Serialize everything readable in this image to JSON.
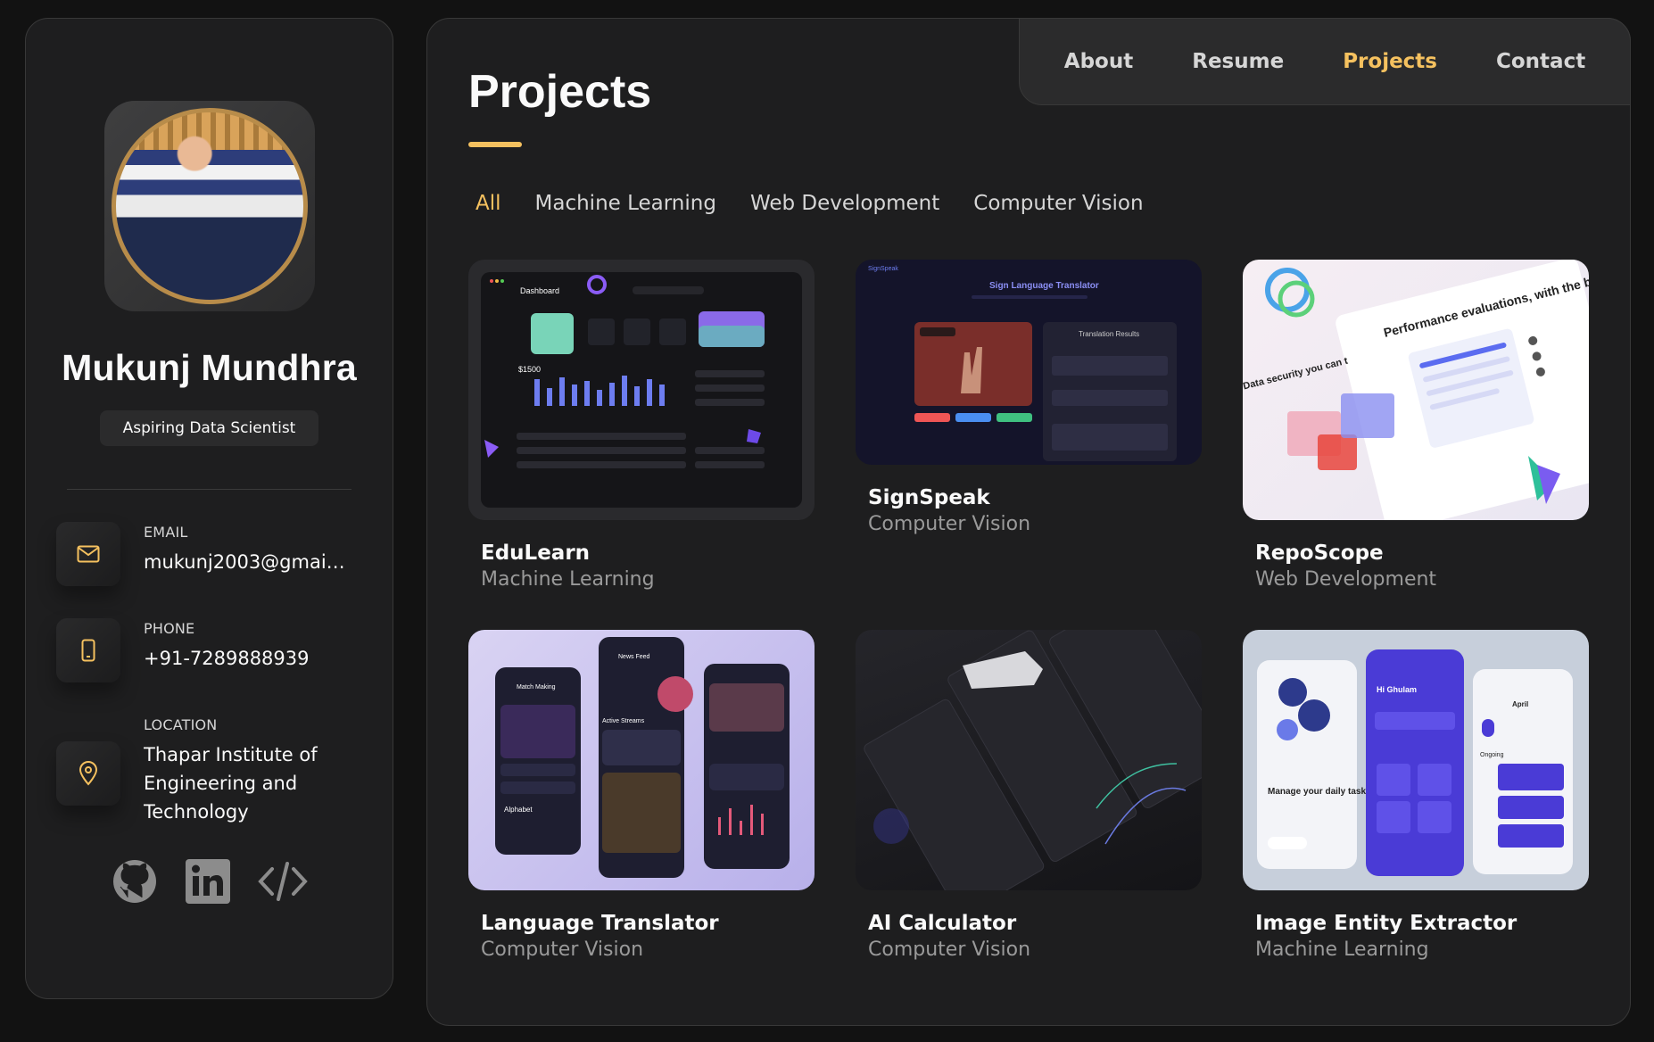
{
  "profile": {
    "name": "Mukunj Mundhra",
    "title": "Aspiring Data Scientist",
    "contacts": [
      {
        "label": "EMAIL",
        "value": "mukunj2003@gmail...",
        "icon": "mail-icon"
      },
      {
        "label": "PHONE",
        "value": "+91-7289888939",
        "icon": "phone-icon"
      },
      {
        "label": "LOCATION",
        "value": "Thapar Institute of Engineering and Technology",
        "icon": "location-pin-icon"
      }
    ],
    "socials": [
      "github-icon",
      "linkedin-icon",
      "code-icon"
    ]
  },
  "nav": {
    "items": [
      "About",
      "Resume",
      "Projects",
      "Contact"
    ],
    "active": "Projects"
  },
  "page": {
    "title": "Projects"
  },
  "filters": {
    "items": [
      "All",
      "Machine Learning",
      "Web Development",
      "Computer Vision"
    ],
    "active": "All"
  },
  "projects": [
    {
      "title": "EduLearn",
      "category": "Machine Learning"
    },
    {
      "title": "SignSpeak",
      "category": "Computer Vision"
    },
    {
      "title": "RepoScope",
      "category": "Web Development"
    },
    {
      "title": "Language Translator",
      "category": "Computer Vision"
    },
    {
      "title": "AI Calculator",
      "category": "Computer Vision"
    },
    {
      "title": "Image Entity Extractor",
      "category": "Machine Learning"
    }
  ],
  "thumbnail_text": {
    "dashboard": "Dashboard",
    "dashboard_amount": "$1500",
    "sign_brand": "SignSpeak",
    "sign_heading": "Sign Language Translator",
    "sign_results": "Translation Results",
    "repo_headline": "Performance evaluations, with the bias",
    "repo_side": "Data security you can t",
    "lang_feed": "News Feed",
    "lang_match": "Match Making",
    "lang_streams": "Active Streams",
    "lang_alphabet": "Alphabet",
    "img_tasks": "Manage your daily tasks",
    "img_greeting": "Hi Ghulam",
    "img_month": "April",
    "img_ongoing": "Ongoing"
  },
  "colors": {
    "accent": "#f5c15f",
    "background": "#121212",
    "panel": "#1e1e1f"
  }
}
